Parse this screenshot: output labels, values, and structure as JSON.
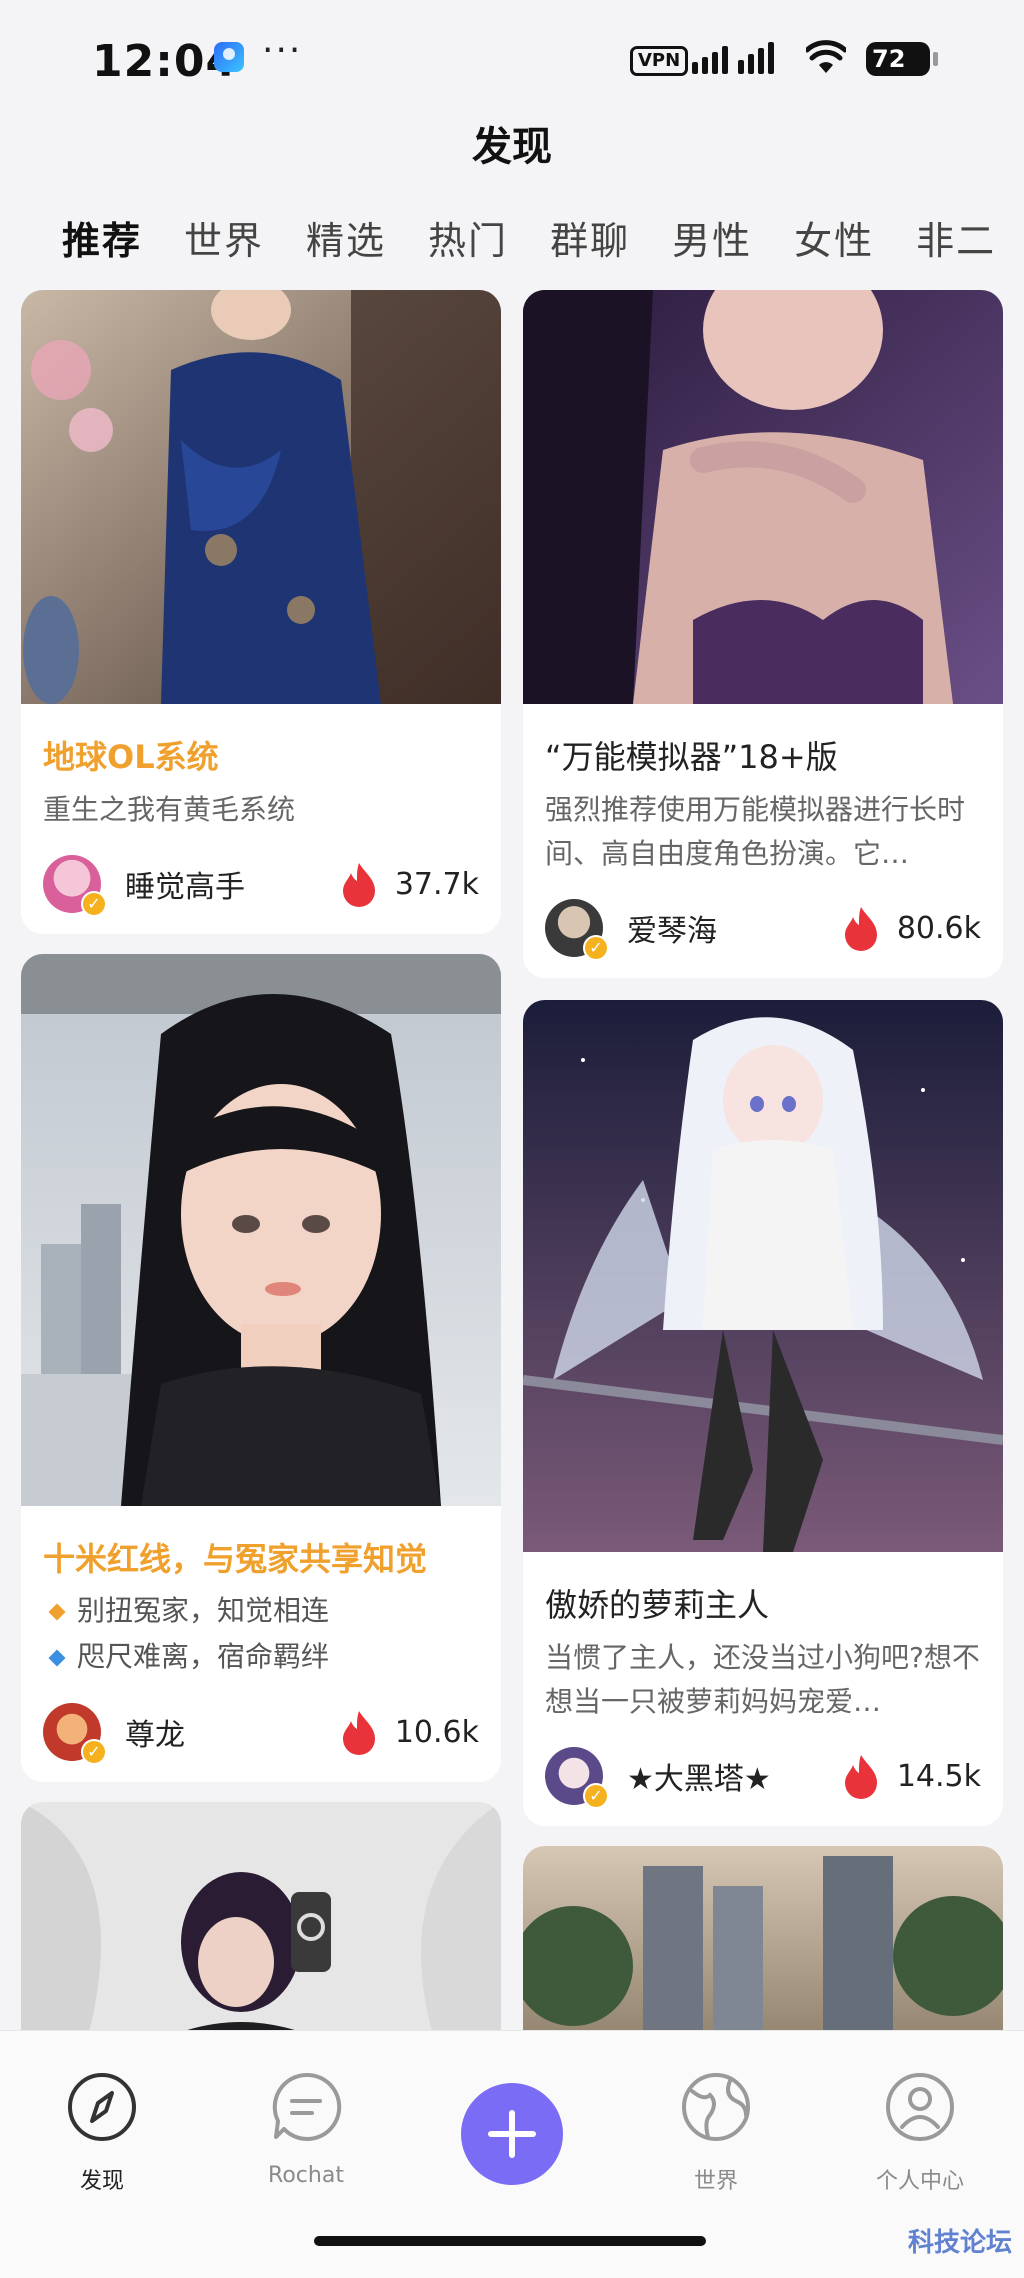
{
  "status_bar": {
    "time": "12:04",
    "more_icon": "···",
    "vpn": "VPN",
    "battery": "72"
  },
  "header": {
    "title": "发现"
  },
  "tabs": [
    {
      "label": "推荐",
      "active": true
    },
    {
      "label": "世界"
    },
    {
      "label": "精选"
    },
    {
      "label": "热门"
    },
    {
      "label": "群聊"
    },
    {
      "label": "男性"
    },
    {
      "label": "女性"
    },
    {
      "label": "非二"
    }
  ],
  "cards": [
    {
      "title": "地球OL系统",
      "desc": "重生之我有黄毛系统",
      "author": "睡觉高手",
      "count": "37.7k"
    },
    {
      "title": "“万能模拟器”18+版",
      "desc": "强烈推荐使用万能模拟器进行长时间、高自由度角色扮演。它…",
      "author": "爱琴海",
      "count": "80.6k"
    },
    {
      "title": "十米红线，与冤家共享知觉",
      "bullets": [
        "别扭冤家，知觉相连",
        "咫尺难离，宿命羁绊"
      ],
      "author": "尊龙",
      "count": "10.6k"
    },
    {
      "title": "傲娇的萝莉主人",
      "desc": "当惯了主人，还没当过小狗吧?想不想当一只被萝莉妈妈宠爱…",
      "author": "★大黑塔★",
      "count": "14.5k"
    }
  ],
  "bottom_nav": {
    "items": [
      {
        "label": "发现",
        "icon": "compass-icon",
        "active": true
      },
      {
        "label": "Rochat",
        "icon": "chat-icon"
      },
      {
        "label": "世界",
        "icon": "globe-icon"
      },
      {
        "label": "个人中心",
        "icon": "profile-icon"
      }
    ],
    "create_icon": "plus-icon"
  },
  "watermark": "科技论坛",
  "colors": {
    "accent": "#7b6cf6",
    "title_highlight": "#f0a02c",
    "flame": "#e8333a",
    "verified": "#f5b21e"
  }
}
